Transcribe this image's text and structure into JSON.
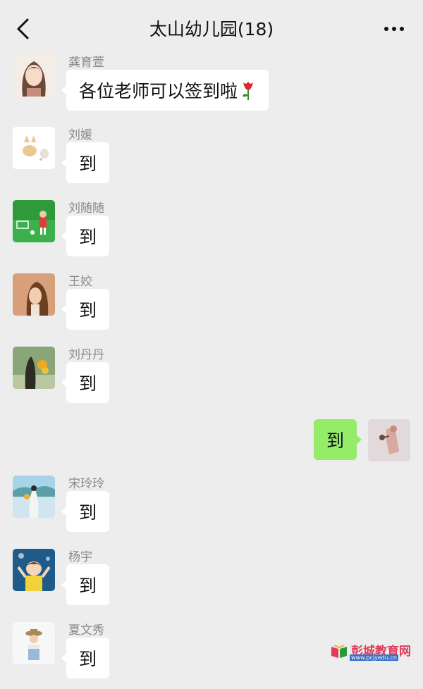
{
  "header": {
    "title": "太山幼儿园(18)"
  },
  "messages": [
    {
      "sender": "龚育萱",
      "text": "各位老师可以签到啦",
      "avatar_icon": "girl-illustration-avatar",
      "has_emoji": "tulip-emoji"
    },
    {
      "sender": "刘媛",
      "text": "到",
      "avatar_icon": "cartoon-fox-avatar"
    },
    {
      "sender": "刘随随",
      "text": "到",
      "avatar_icon": "child-on-field-avatar"
    },
    {
      "sender": "王姣",
      "text": "到",
      "avatar_icon": "woman-portrait-avatar"
    },
    {
      "sender": "刘丹丹",
      "text": "到",
      "avatar_icon": "girl-with-flowers-avatar"
    },
    {
      "sender": "",
      "text": "到",
      "avatar_icon": "self-avatar",
      "self": true
    },
    {
      "sender": "宋玲玲",
      "text": "到",
      "avatar_icon": "girl-by-lake-avatar"
    },
    {
      "sender": "杨宇",
      "text": "到",
      "avatar_icon": "cartoon-girl-avatar"
    },
    {
      "sender": "夏文秀",
      "text": "到",
      "avatar_icon": "girl-with-hat-avatar"
    }
  ],
  "watermark": {
    "name": "彭城教育网",
    "url": "www.pcjyedu.cn"
  },
  "colors": {
    "background": "#ededed",
    "bubble_other": "#ffffff",
    "bubble_self": "#95ec69",
    "name_text": "#8a8a8a"
  }
}
